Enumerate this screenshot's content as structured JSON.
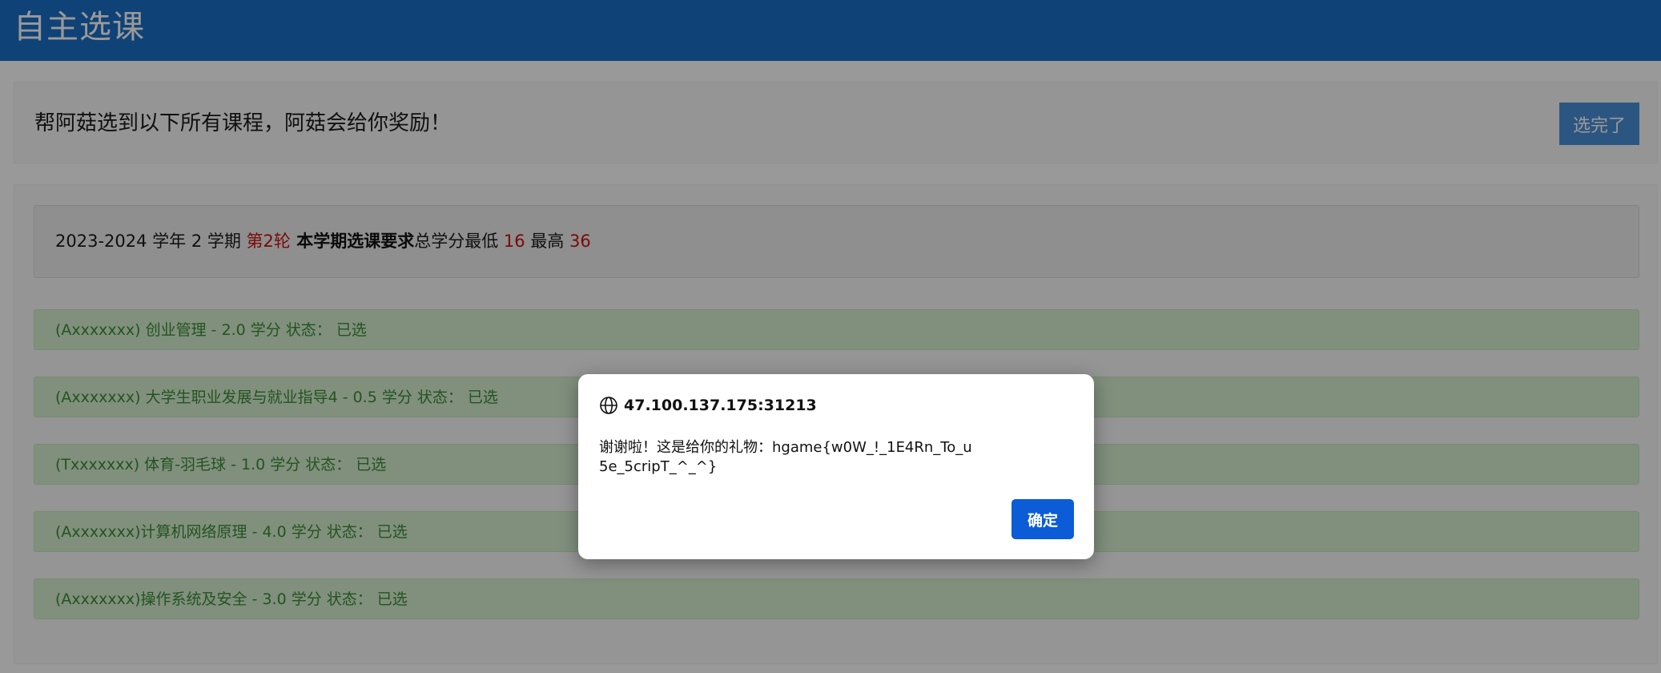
{
  "header": {
    "title": "自主选课"
  },
  "task": {
    "text": "帮阿菇选到以下所有课程，阿菇会给你奖励！",
    "done_button": "选完了"
  },
  "term": {
    "prefix": "2023-2024 学年 2 学期 ",
    "round": "第2轮",
    "requirement_label": " 本学期选课要求",
    "credit_min_label": "总学分最低 ",
    "credit_min": "16",
    "credit_max_label": " 最高 ",
    "credit_max": "36"
  },
  "courses": [
    {
      "text": "(Axxxxxxx) 创业管理 - 2.0 学分 状态： 已选"
    },
    {
      "text": "(Axxxxxxx) 大学生职业发展与就业指导4 - 0.5 学分 状态： 已选"
    },
    {
      "text": "(Txxxxxxx) 体育-羽毛球 - 1.0 学分 状态： 已选"
    },
    {
      "text": "(Axxxxxxx)计算机网络原理 - 4.0 学分 状态： 已选"
    },
    {
      "text": "(Axxxxxxx)操作系统及安全 - 3.0 学分 状态： 已选"
    }
  ],
  "dialog": {
    "origin": "47.100.137.175:31213",
    "message": "谢谢啦！这是给你的礼物：hgame{w0W_!_1E4Rn_To_u5e_5cripT_^_^}",
    "ok_button": "确定"
  },
  "colors": {
    "header": "#1a6fc7",
    "accent_red": "#cc1111",
    "course_bg": "#d6f0d0",
    "course_text": "#3d8a36",
    "dialog_ok": "#0b5cd6"
  }
}
